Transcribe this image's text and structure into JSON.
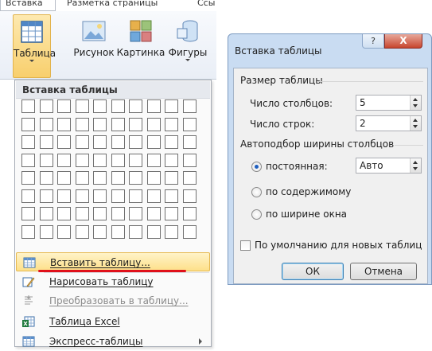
{
  "ribbon": {
    "tabs": [
      "Вставка",
      "Разметка страницы",
      "Ссы"
    ],
    "buttons": {
      "table": "Таблица",
      "picture": "Рисунок",
      "clipart": "Картинка",
      "shapes": "Фигуры"
    }
  },
  "dropdown": {
    "header": "Вставка таблицы",
    "grid": {
      "columns": 10,
      "rows": 8
    },
    "items": [
      {
        "label": "Вставить таблицу...",
        "icon": "insert-table-icon",
        "enabled": true,
        "highlighted": true
      },
      {
        "label": "Нарисовать таблицу",
        "icon": "draw-table-icon",
        "enabled": true
      },
      {
        "label": "Преобразовать в таблицу...",
        "icon": "convert-to-table-icon",
        "enabled": false
      },
      {
        "label": "Таблица Excel",
        "icon": "excel-table-icon",
        "enabled": true
      },
      {
        "label": "Экспресс-таблицы",
        "icon": "quick-tables-icon",
        "enabled": true,
        "submenu": true
      }
    ]
  },
  "dialog": {
    "title": "Вставка таблицы",
    "help_glyph": "?",
    "close_glyph": "X",
    "size_group": "Размер таблицы",
    "columns_label": "Число столбцов:",
    "columns_value": "5",
    "rows_label": "Число строк:",
    "rows_value": "2",
    "autofit_group": "Автоподбор ширины столбцов",
    "fixed_label": "постоянная:",
    "fixed_value": "Авто",
    "content_label": "по содержимому",
    "window_label": "по ширине окна",
    "selected_option": "fixed",
    "default_label": "По умолчанию для новых таблиц",
    "default_checked": false,
    "ok": "ОК",
    "cancel": "Отмена"
  },
  "colors": {
    "highlight": "#fde08a",
    "annotation_line": "#e0101a",
    "dialog_frame": "#c9dcf2",
    "close_button": "#c7452e"
  }
}
